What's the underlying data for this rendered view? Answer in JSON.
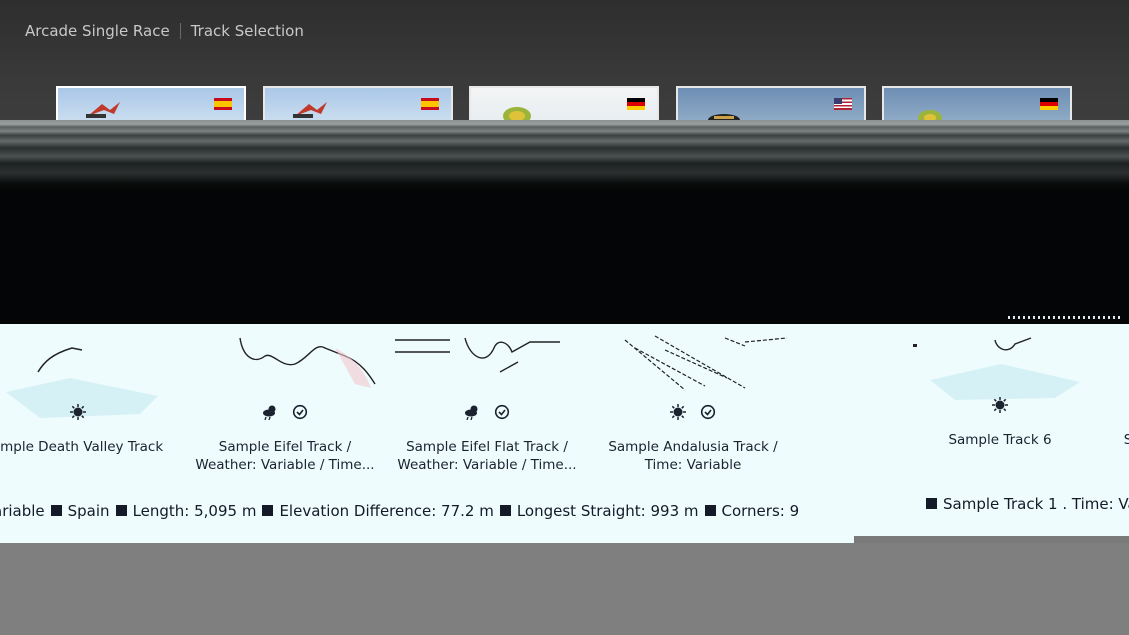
{
  "header": {
    "crumb1": "Arcade Single Race",
    "crumb2": "Track Selection"
  },
  "cards": [
    {
      "flag": "es",
      "selected": true
    },
    {
      "flag": "es",
      "selected": false
    },
    {
      "flag": "de",
      "selected": false
    },
    {
      "flag": "us",
      "selected": false
    },
    {
      "flag": "de",
      "selected": false
    }
  ],
  "tracks": [
    {
      "name_line1": "ample Death Valley Track",
      "name_line2": "",
      "icons": [
        "sun-icon"
      ]
    },
    {
      "name_line1": "Sample Eifel Track /",
      "name_line2": "Weather: Variable / Time...",
      "icons": [
        "weather-variable-icon",
        "time-variable-icon"
      ]
    },
    {
      "name_line1": "Sample Eifel Flat Track /",
      "name_line2": "Weather: Variable / Time...",
      "icons": [
        "weather-variable-icon",
        "time-variable-icon"
      ]
    },
    {
      "name_line1": "Sample Andalusia Track /",
      "name_line2": "Time: Variable",
      "icons": [
        "sun-icon",
        "time-variable-icon"
      ]
    },
    {
      "name_line1": "Sample Track 6",
      "name_line2": "",
      "icons": [
        "sun-icon"
      ]
    },
    {
      "name_line1": "S",
      "name_line2": "",
      "icons": []
    }
  ],
  "info": {
    "weather": "ariable",
    "country": "Spain",
    "length": "Length: 5,095 m",
    "elevation": "Elevation Difference: 77.2 m",
    "straight": "Longest Straight: 993 m",
    "corners": "Corners: 9"
  },
  "info2": {
    "text": "Sample Track 1",
    "extra": "Time: Va"
  }
}
